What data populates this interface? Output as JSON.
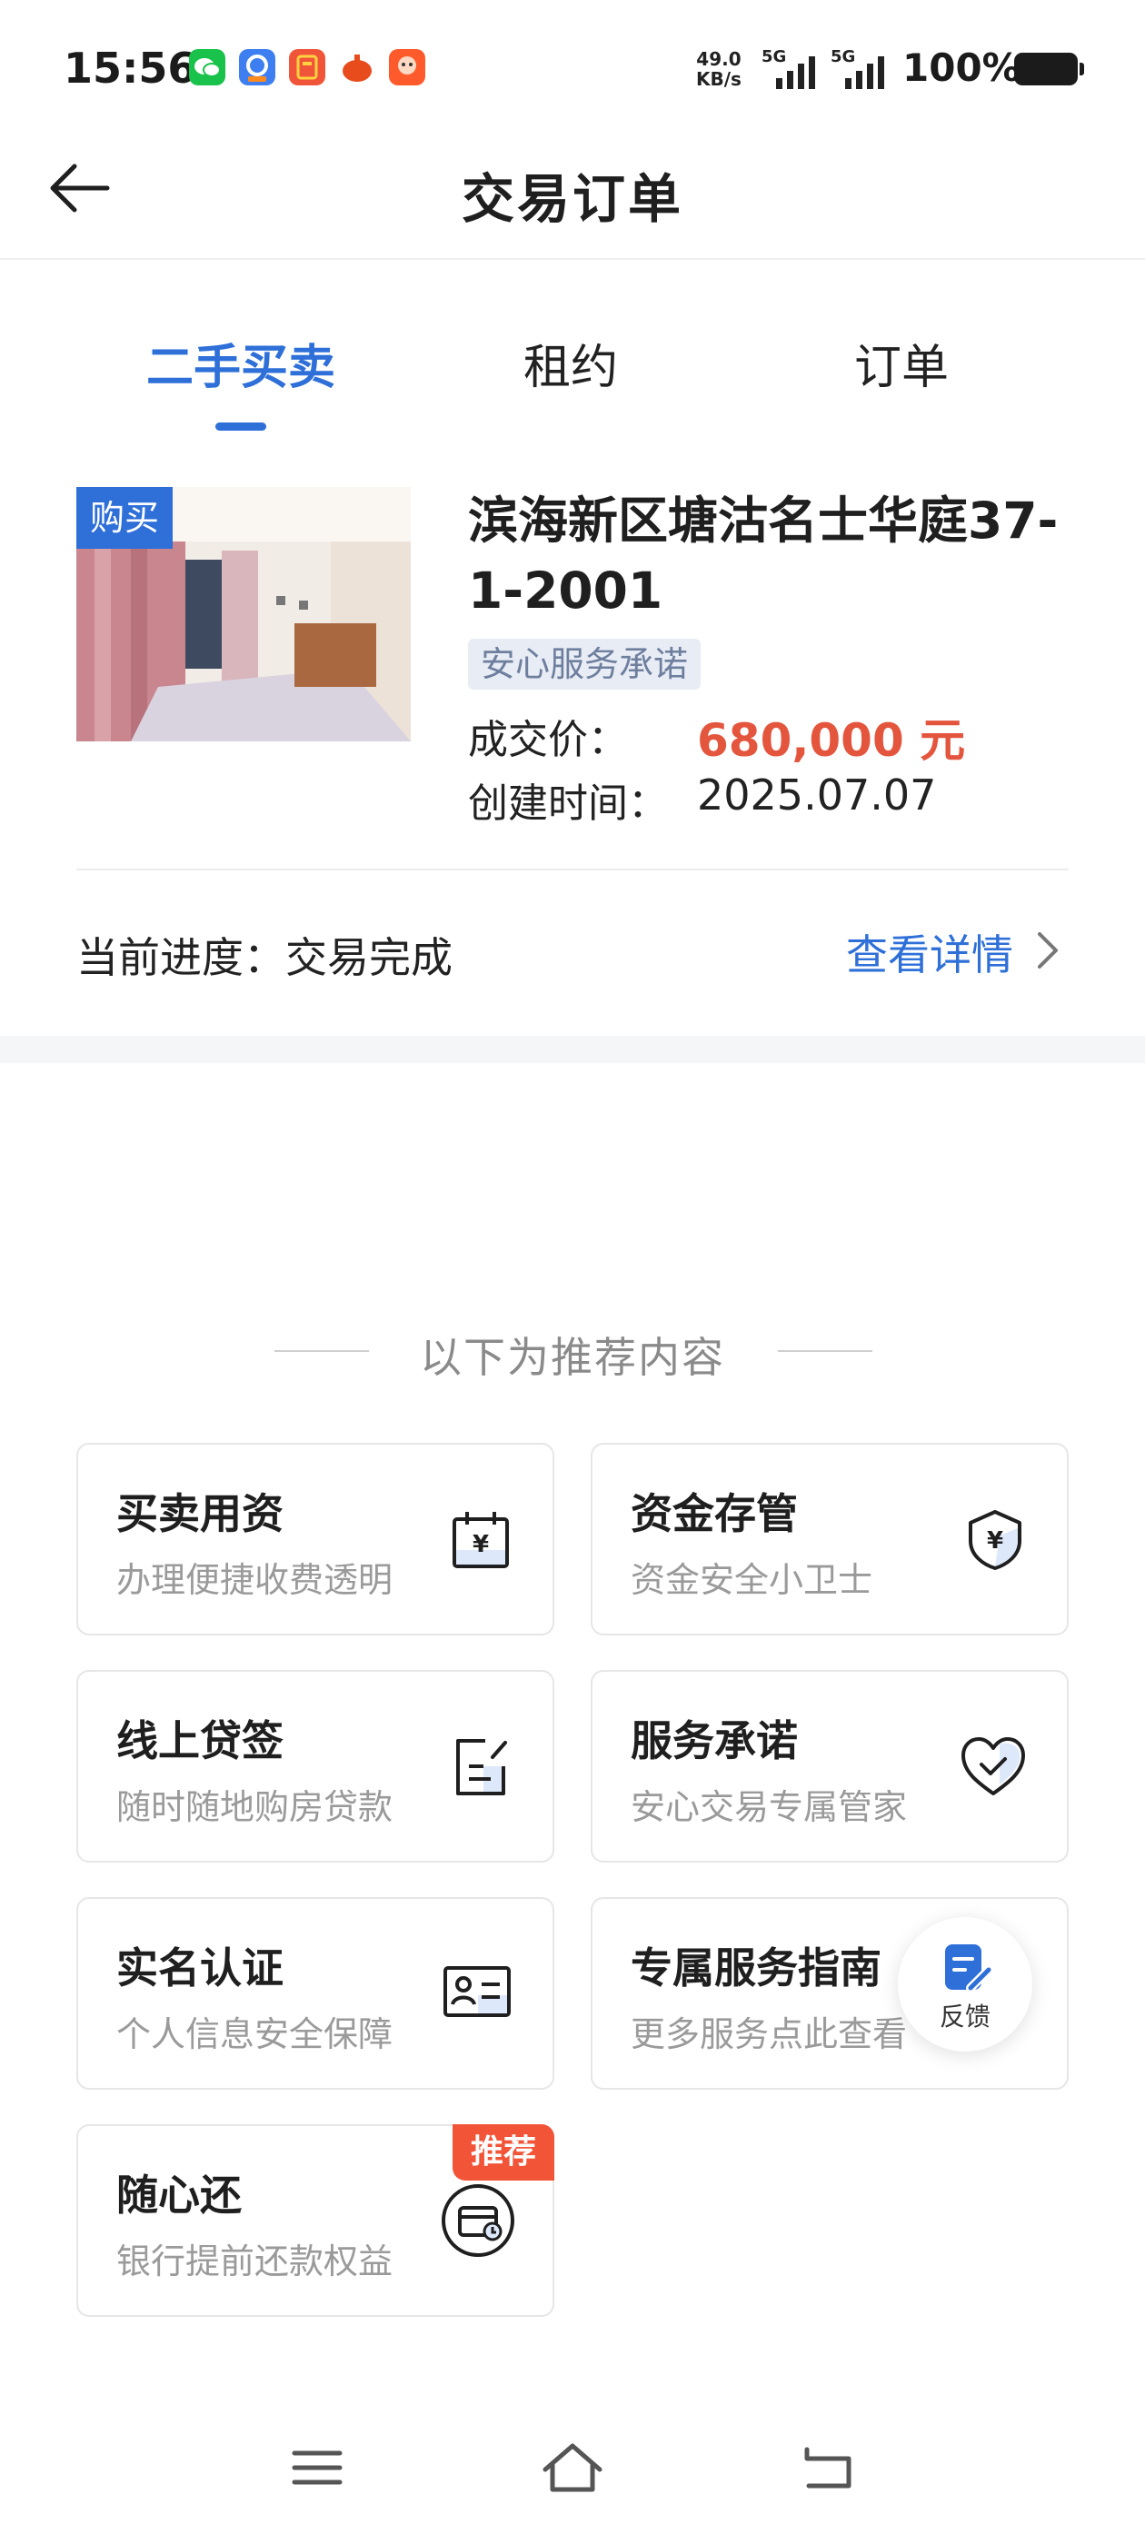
{
  "status_bar": {
    "time": "15:56",
    "net_speed_value": "49.0",
    "net_speed_unit": "KB/s",
    "sim1_label": "5G",
    "sim2_label": "5G",
    "battery": "100%"
  },
  "header": {
    "title": "交易订单"
  },
  "tabs": [
    {
      "label": "二手买卖",
      "active": true
    },
    {
      "label": "租约",
      "active": false
    },
    {
      "label": "订单",
      "active": false
    }
  ],
  "order": {
    "badge": "购买",
    "title_line1": "滨海新区塘沽名士华庭37-",
    "title_line2": "1-2001",
    "promise_tag": "安心服务承诺",
    "price_label": "成交价：",
    "price_value": "680,000 元",
    "created_label": "创建时间：",
    "created_value": "2025.07.07",
    "progress": "当前进度：交易完成",
    "detail_link": "查看详情"
  },
  "recommend": {
    "heading": "以下为推荐内容",
    "cards": [
      {
        "title": "买卖用资",
        "subtitle": "办理便捷收费透明",
        "icon": "calendar-yen-icon"
      },
      {
        "title": "资金存管",
        "subtitle": "资金安全小卫士",
        "icon": "shield-yen-icon"
      },
      {
        "title": "线上贷签",
        "subtitle": "随时随地购房贷款",
        "icon": "document-sign-icon"
      },
      {
        "title": "服务承诺",
        "subtitle": "安心交易专属管家",
        "icon": "heart-check-icon"
      },
      {
        "title": "实名认证",
        "subtitle": "个人信息安全保障",
        "icon": "id-card-icon"
      },
      {
        "title": "专属服务指南",
        "subtitle": "更多服务点此查看",
        "icon": "guide-icon"
      },
      {
        "title": "随心还",
        "subtitle": "银行提前还款权益",
        "icon": "card-clock-icon",
        "tag": "推荐"
      }
    ]
  },
  "feedback": {
    "label": "反馈"
  },
  "colors": {
    "accent": "#2e6fd8",
    "price": "#e4553e",
    "tag_red": "#f25438"
  }
}
